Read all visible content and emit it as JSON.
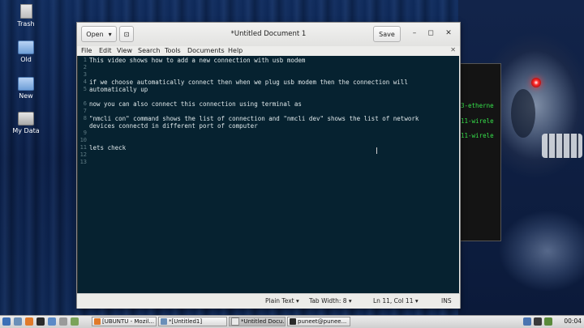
{
  "desktop": {
    "icons": [
      {
        "label": "Trash"
      },
      {
        "label": "Old"
      },
      {
        "label": "New"
      },
      {
        "label": "My Data"
      }
    ]
  },
  "terminal": {
    "lines": [
      "3-etherne",
      "11-wirele",
      "11-wirele"
    ]
  },
  "window": {
    "open_label": "Open",
    "open_arrow": "▾",
    "pin_glyph": "⊡",
    "title": "*Untitled Document 1",
    "save_label": "Save",
    "minimize": "–",
    "maximize": "◻",
    "close": "✕"
  },
  "menu": {
    "items": [
      "File",
      "Edit",
      "View",
      "Search",
      "Tools",
      "Documents",
      "Help"
    ],
    "close_glyph": "✕"
  },
  "editor": {
    "line_numbers": [
      "1",
      "2",
      "3",
      "4",
      "5",
      "6",
      "7",
      "8",
      "9",
      "10",
      "11",
      "12",
      "13"
    ],
    "lines": [
      "This video shows how to add a new connection with usb modem",
      "",
      "",
      "if we choose automatically connect then when we plug usb modem then the connection will",
      "automatically up",
      "",
      "now you can also connect this connection using terminal as",
      "",
      "\"nmcli con\" command shows the list of connection and \"nmcli dev\" shows the list of network",
      "devices connectd in different port of computer",
      "",
      "",
      "lets check"
    ]
  },
  "statusbar": {
    "language": "Plain Text ▾",
    "tab_width": "Tab Width: 8 ▾",
    "position": "Ln 11, Col 11 ▾",
    "mode": "INS"
  },
  "taskbar": {
    "tasks": [
      "[UBUNTU - Mozil...",
      "*[Untitled1]",
      "*Untitled Docu...",
      "puneet@punee..."
    ],
    "clock": "00:04"
  },
  "colors": {
    "editor_bg": "#062230",
    "terminal_text": "#36e04a"
  }
}
